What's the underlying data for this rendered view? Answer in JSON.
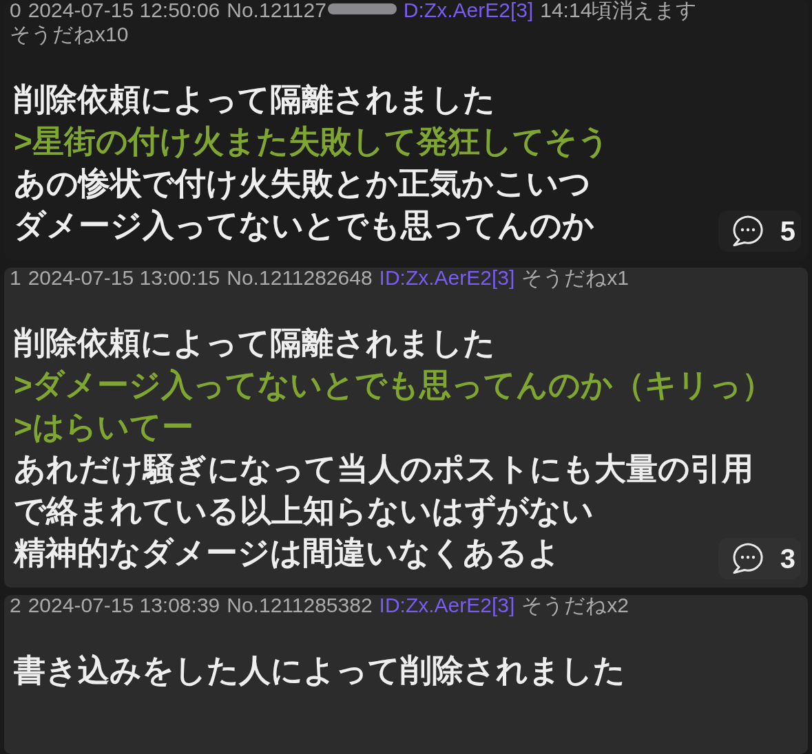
{
  "posts": [
    {
      "kind": "op",
      "index": "0",
      "datetime": "2024-07-15 12:50:06",
      "number": "No.121127",
      "redacted": true,
      "id": "D:Zx.AerE2[3]",
      "expiry": "14:14頃消えます",
      "soudane": "そうだねx10",
      "lines": [
        {
          "text": "削除依頼によって隔離されました",
          "quote": false
        },
        {
          "text": ">星街の付け火また失敗して発狂してそう",
          "quote": true
        },
        {
          "text": "あの惨状で付け火失敗とか正気かこいつ",
          "quote": false
        },
        {
          "text": "ダメージ入ってないとでも思ってんのか",
          "quote": false
        }
      ],
      "replies": "5"
    },
    {
      "kind": "reply",
      "index": "1",
      "datetime": "2024-07-15 13:00:15",
      "number": "No.1211282648",
      "redacted": false,
      "id": "ID:Zx.AerE2[3]",
      "soudane": "そうだねx1",
      "lines": [
        {
          "text": "削除依頼によって隔離されました",
          "quote": false
        },
        {
          "text": ">ダメージ入ってないとでも思ってんのか（キリっ）",
          "quote": true
        },
        {
          "text": ">はらいてー",
          "quote": true
        },
        {
          "text": "あれだけ騒ぎになって当人のポストにも大量の引用",
          "quote": false
        },
        {
          "text": "で絡まれている以上知らないはずがない",
          "quote": false
        },
        {
          "text": "精神的なダメージは間違いなくあるよ",
          "quote": false
        }
      ],
      "replies": "3"
    },
    {
      "kind": "reply",
      "index": "2",
      "datetime": "2024-07-15 13:08:39",
      "number": "No.1211285382",
      "redacted": false,
      "id": "ID:Zx.AerE2[3]",
      "soudane": "そうだねx2",
      "lines": [
        {
          "text": "書き込みをした人によって削除されました",
          "quote": false
        }
      ]
    }
  ]
}
